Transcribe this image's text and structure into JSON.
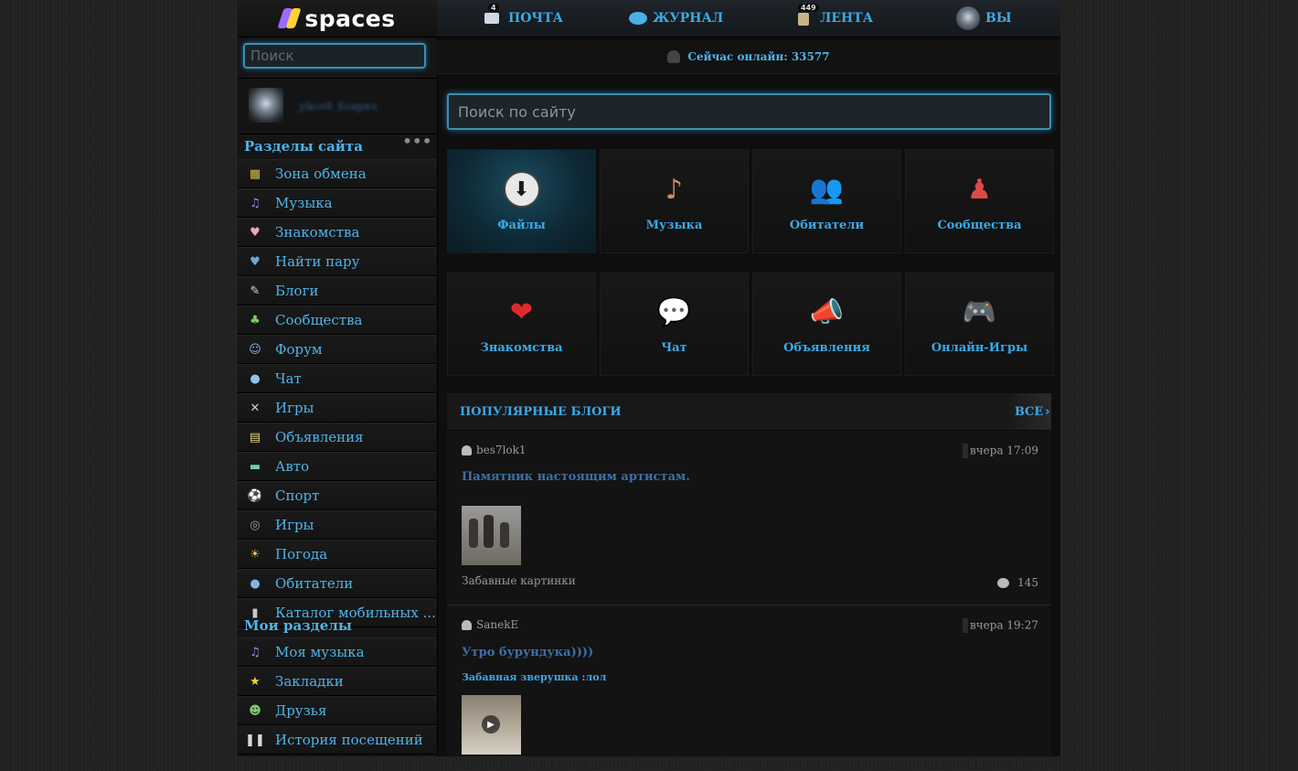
{
  "brand": {
    "name": "spaces"
  },
  "sidebar": {
    "search_placeholder": "Поиск",
    "username": "_ylkov8_Боярнч",
    "sections_title": "Разделы сайта",
    "more_icon": "more-dots-icon",
    "items": [
      {
        "label": "Зона обмена",
        "icon": "grid-icon",
        "glyph": "▦",
        "color": "#d9c24a"
      },
      {
        "label": "Музыка",
        "icon": "music-note-icon",
        "glyph": "♫",
        "color": "#a58be0"
      },
      {
        "label": "Знакомства",
        "icon": "heart-icon",
        "glyph": "♥",
        "color": "#f0a5b6"
      },
      {
        "label": "Найти пару",
        "icon": "broken-heart-icon",
        "glyph": "♥",
        "color": "#6aa8e6"
      },
      {
        "label": "Блоги",
        "icon": "pencil-icon",
        "glyph": "✎",
        "color": "#d8d8d8"
      },
      {
        "label": "Сообщества",
        "icon": "group-icon",
        "glyph": "♣",
        "color": "#7ecf5a"
      },
      {
        "label": "Форум",
        "icon": "forum-icon",
        "glyph": "☺",
        "color": "#8ab6e0"
      },
      {
        "label": "Чат",
        "icon": "chat-bubble-icon",
        "glyph": "●",
        "color": "#8fc4ea"
      },
      {
        "label": "Игры",
        "icon": "crossed-swords-icon",
        "glyph": "✕",
        "color": "#d0d0d0"
      },
      {
        "label": "Объявления",
        "icon": "notepad-icon",
        "glyph": "▤",
        "color": "#e8d27a"
      },
      {
        "label": "Авто",
        "icon": "car-icon",
        "glyph": "▬",
        "color": "#6dcfa2"
      },
      {
        "label": "Спорт",
        "icon": "ball-icon",
        "glyph": "⚽",
        "color": "#e6e6e6"
      },
      {
        "label": "Игры",
        "icon": "gamepad-icon",
        "glyph": "◎",
        "color": "#8fb0a0"
      },
      {
        "label": "Погода",
        "icon": "weather-icon",
        "glyph": "☀",
        "color": "#f2c14e"
      },
      {
        "label": "Обитатели",
        "icon": "user-icon",
        "glyph": "●",
        "color": "#7fb6e8"
      },
      {
        "label": "Каталог мобильных ...",
        "icon": "phone-icon",
        "glyph": "▮",
        "color": "#c8c8c8"
      }
    ],
    "my_title": "Мои разделы",
    "my_items": [
      {
        "label": "Моя музыка",
        "icon": "music-note-icon",
        "glyph": "♫",
        "color": "#a58be0"
      },
      {
        "label": "Закладки",
        "icon": "star-icon",
        "glyph": "★",
        "color": "#f2d33b"
      },
      {
        "label": "Друзья",
        "icon": "friends-icon",
        "glyph": "☻",
        "color": "#7fc66e"
      },
      {
        "label": "История посещений",
        "icon": "footprints-icon",
        "glyph": "❚❚",
        "color": "#d8d8d8"
      }
    ]
  },
  "topnav": {
    "mail": {
      "label": "ПОЧТА",
      "badge": "4"
    },
    "journal": {
      "label": "ЖУРНАЛ"
    },
    "feed": {
      "label": "ЛЕНТА",
      "badge": "449"
    },
    "you": {
      "label": "ВЫ"
    }
  },
  "online": {
    "text": "Сейчас онлайн: 33577"
  },
  "main_search": {
    "placeholder": "Поиск по сайту"
  },
  "tiles": [
    {
      "label": "Файлы",
      "icon": "download-icon",
      "glyph": "⬇",
      "color": "#ffffff"
    },
    {
      "label": "Музыка",
      "icon": "music-girl-icon",
      "glyph": "♪",
      "color": "#d08a6a"
    },
    {
      "label": "Обитатели",
      "icon": "people-icon",
      "glyph": "👥",
      "color": "#4a9be0"
    },
    {
      "label": "Сообщества",
      "icon": "communities-icon",
      "glyph": "♟",
      "color": "#e04848"
    },
    {
      "label": "Знакомства",
      "icon": "big-heart-icon",
      "glyph": "❤",
      "color": "#e02a2a"
    },
    {
      "label": "Чат",
      "icon": "chat-bubbles-icon",
      "glyph": "💬",
      "color": "#4ab8e8"
    },
    {
      "label": "Объявления",
      "icon": "megaphone-icon",
      "glyph": "📣",
      "color": "#e8b844"
    },
    {
      "label": "Онлайн-Игры",
      "icon": "gamepad-icon",
      "glyph": "🎮",
      "color": "#9a9a9a"
    }
  ],
  "blogs": {
    "title": "ПОПУЛЯРНЫЕ БЛОГИ",
    "all_label": "ВСЕ",
    "posts": [
      {
        "author": "bes7lok1",
        "time": "вчера 17:09",
        "title": "Памятник настоящим артистам.",
        "category": "Забавные картинки",
        "comments": "145"
      },
      {
        "author": "SanekE",
        "time": "вчера 19:27",
        "title": "Утро бурундука))))",
        "subtitle": "Забавная зверушка :лол"
      }
    ]
  }
}
